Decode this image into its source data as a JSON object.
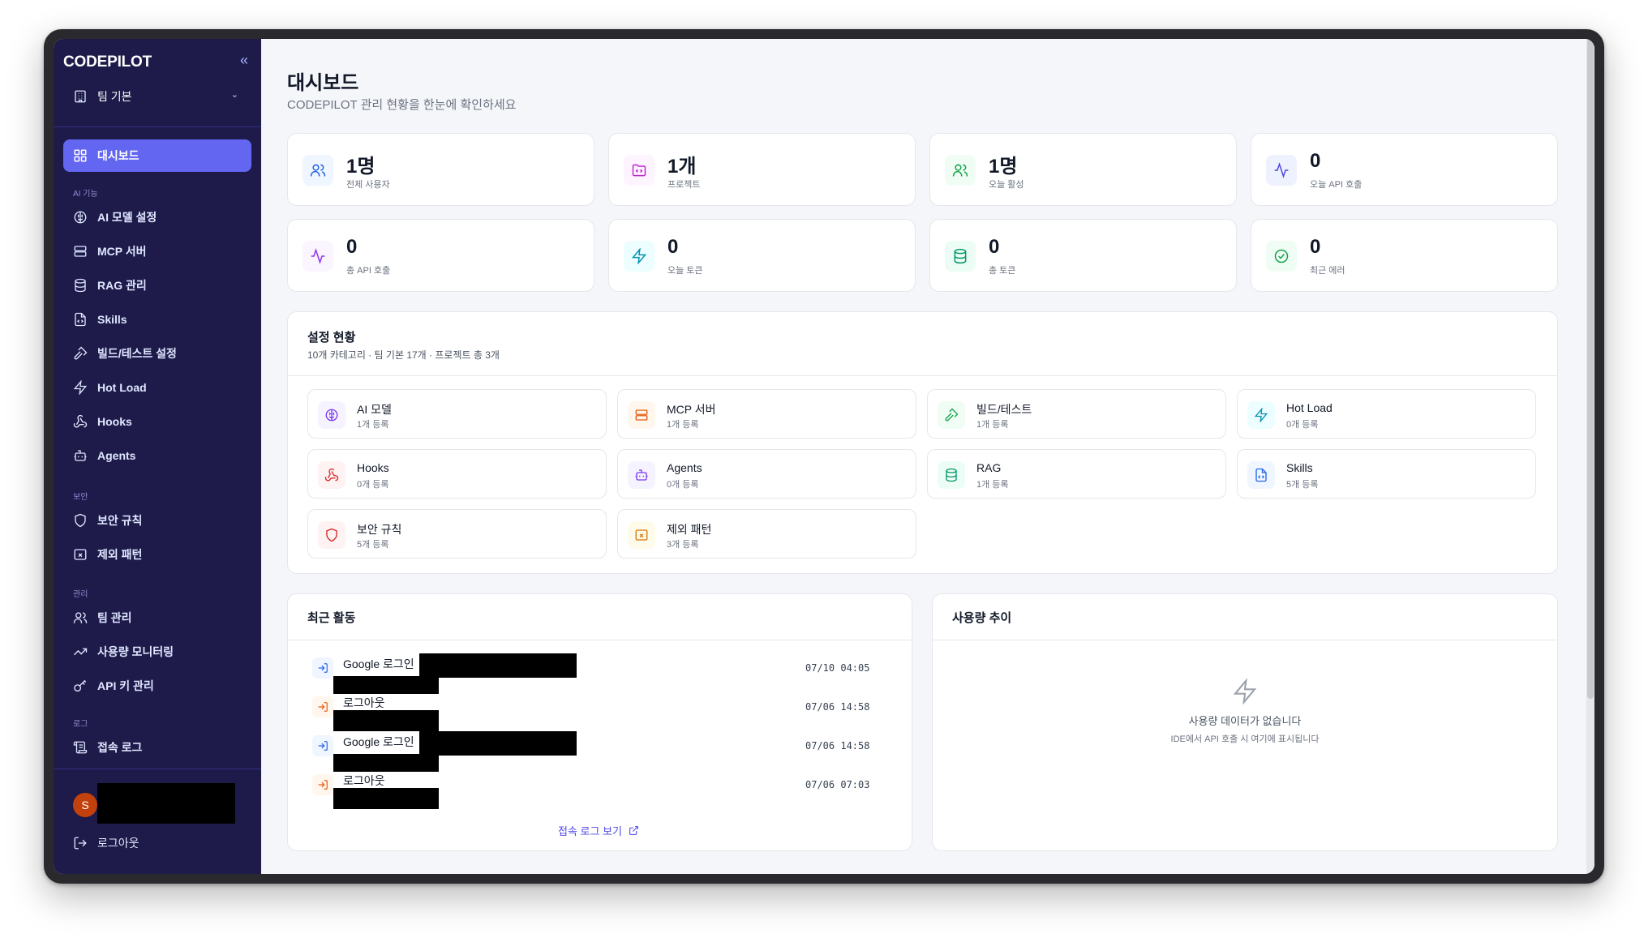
{
  "app": {
    "brand": "CODEPILOT",
    "collapse_glyph": "«"
  },
  "team": {
    "label": "팀 기본"
  },
  "sidebar": {
    "dashboard": "대시보드",
    "sections": {
      "ai": "AI 기능",
      "security": "보안",
      "admin": "관리",
      "log": "로그"
    },
    "ai_items": [
      {
        "label": "AI 모델 설정",
        "icon": "brain-icon"
      },
      {
        "label": "MCP 서버",
        "icon": "server-icon"
      },
      {
        "label": "RAG 관리",
        "icon": "database-icon"
      },
      {
        "label": "Skills",
        "icon": "file-code-icon"
      },
      {
        "label": "빌드/테스트 설정",
        "icon": "hammer-icon"
      },
      {
        "label": "Hot Load",
        "icon": "zap-icon"
      },
      {
        "label": "Hooks",
        "icon": "webhook-icon"
      },
      {
        "label": "Agents",
        "icon": "bot-icon"
      }
    ],
    "security_items": [
      {
        "label": "보안 규칙",
        "icon": "shield-icon"
      },
      {
        "label": "제외 패턴",
        "icon": "folder-x-icon"
      }
    ],
    "admin_items": [
      {
        "label": "팀 관리",
        "icon": "users-icon"
      },
      {
        "label": "사용량 모니터링",
        "icon": "trending-up-icon"
      },
      {
        "label": "API 키 관리",
        "icon": "key-icon"
      }
    ],
    "log_items": [
      {
        "label": "접속 로그",
        "icon": "scroll-icon"
      }
    ],
    "user": {
      "initial": "S"
    },
    "logout": "로그아웃"
  },
  "header": {
    "title": "대시보드",
    "subtitle": "CODEPILOT 관리 현황을 한눈에 확인하세요"
  },
  "stats": [
    {
      "value": "1명",
      "label": "전체 사용자",
      "icon": "users-icon",
      "color": "#2563eb"
    },
    {
      "value": "1개",
      "label": "프로젝트",
      "icon": "folder-icon",
      "color": "#c026d3"
    },
    {
      "value": "1명",
      "label": "오늘 활성",
      "icon": "users-icon",
      "color": "#16a34a"
    },
    {
      "value": "0",
      "label": "오늘 API 호출",
      "icon": "activity-icon",
      "color": "#4f46e5"
    },
    {
      "value": "0",
      "label": "총 API 호출",
      "icon": "activity-icon",
      "color": "#9333ea"
    },
    {
      "value": "0",
      "label": "오늘 토큰",
      "icon": "zap-icon",
      "color": "#0891b2"
    },
    {
      "value": "0",
      "label": "총 토큰",
      "icon": "database-icon",
      "color": "#059669"
    },
    {
      "value": "0",
      "label": "최근 에러",
      "icon": "check-circle-icon",
      "color": "#16a34a"
    }
  ],
  "settings": {
    "title": "설정 현황",
    "subtitle": "10개 카테고리 · 팀 기본 17개 · 프로젝트 총 3개",
    "items": [
      {
        "name": "AI 모델",
        "count": "1개 등록",
        "icon": "brain-icon",
        "color": "#7c3aed"
      },
      {
        "name": "MCP 서버",
        "count": "1개 등록",
        "icon": "server-icon",
        "color": "#ea580c"
      },
      {
        "name": "빌드/테스트",
        "count": "1개 등록",
        "icon": "hammer-icon",
        "color": "#16a34a"
      },
      {
        "name": "Hot Load",
        "count": "0개 등록",
        "icon": "zap-icon",
        "color": "#0891b2"
      },
      {
        "name": "Hooks",
        "count": "0개 등록",
        "icon": "webhook-icon",
        "color": "#dc2626"
      },
      {
        "name": "Agents",
        "count": "0개 등록",
        "icon": "bot-icon",
        "color": "#7c3aed"
      },
      {
        "name": "RAG",
        "count": "1개 등록",
        "icon": "database-icon",
        "color": "#059669"
      },
      {
        "name": "Skills",
        "count": "5개 등록",
        "icon": "file-code-icon",
        "color": "#2563eb"
      },
      {
        "name": "보안 규칙",
        "count": "5개 등록",
        "icon": "shield-icon",
        "color": "#dc2626"
      },
      {
        "name": "제외 패턴",
        "count": "3개 등록",
        "icon": "folder-x-icon",
        "color": "#d97706"
      }
    ]
  },
  "activity": {
    "title": "최근 활동",
    "items": [
      {
        "text": "Google 로그인",
        "time": "07/10 04:05",
        "kind": "login"
      },
      {
        "text": "로그아웃",
        "time": "07/06 14:58",
        "kind": "logout"
      },
      {
        "text": "Google 로그인",
        "time": "07/06 14:58",
        "kind": "login"
      },
      {
        "text": "로그아웃",
        "time": "07/06 07:03",
        "kind": "logout"
      }
    ],
    "link": "접속 로그 보기"
  },
  "usage": {
    "title": "사용량 추이",
    "empty_title": "사용량 데이터가 없습니다",
    "empty_desc": "IDE에서 API 호출 시 여기에 표시됩니다"
  }
}
